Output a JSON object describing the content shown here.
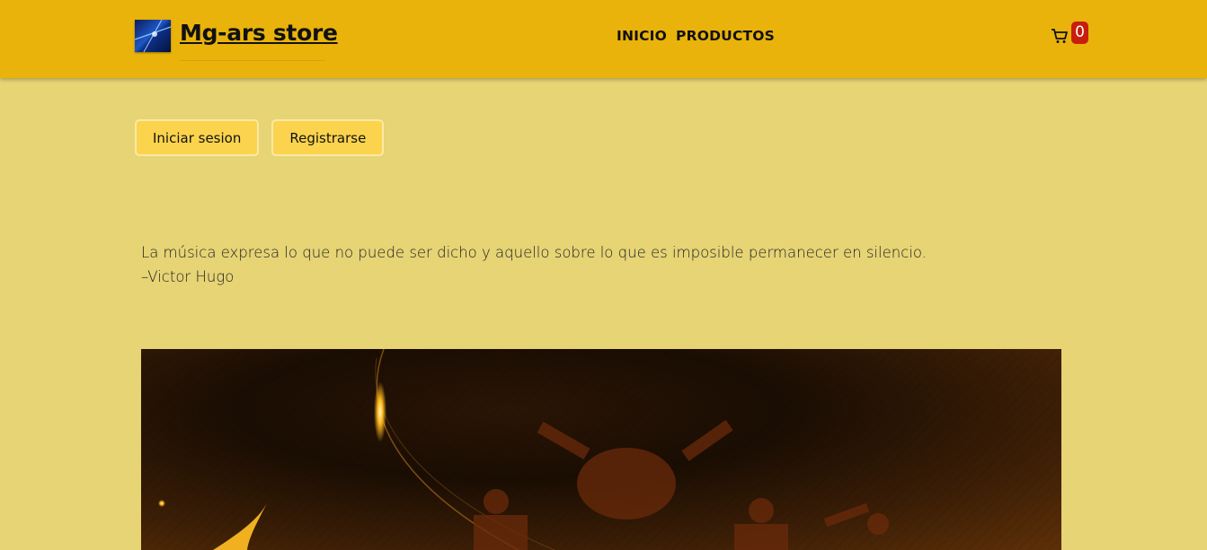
{
  "header": {
    "brand_name": "Mg-ars store",
    "logo_icon": "logo-image",
    "nav": [
      {
        "label": "INICIO"
      },
      {
        "label": "PRODUCTOS"
      }
    ],
    "cart": {
      "icon": "cart-icon",
      "count": "0"
    }
  },
  "auth": {
    "login_label": "Iniciar sesion",
    "register_label": "Registrarse"
  },
  "quote": {
    "text": "La música expresa lo que no puede ser dicho y aquello sobre lo que es imposible permanecer en silencio.",
    "author": "–Victor Hugo"
  },
  "hero": {
    "image": "music-banner-image"
  },
  "colors": {
    "header_bg": "#e9b30b",
    "page_bg": "#e6d475",
    "button_bg": "#fcd34d",
    "badge_bg": "#c81e0e"
  }
}
